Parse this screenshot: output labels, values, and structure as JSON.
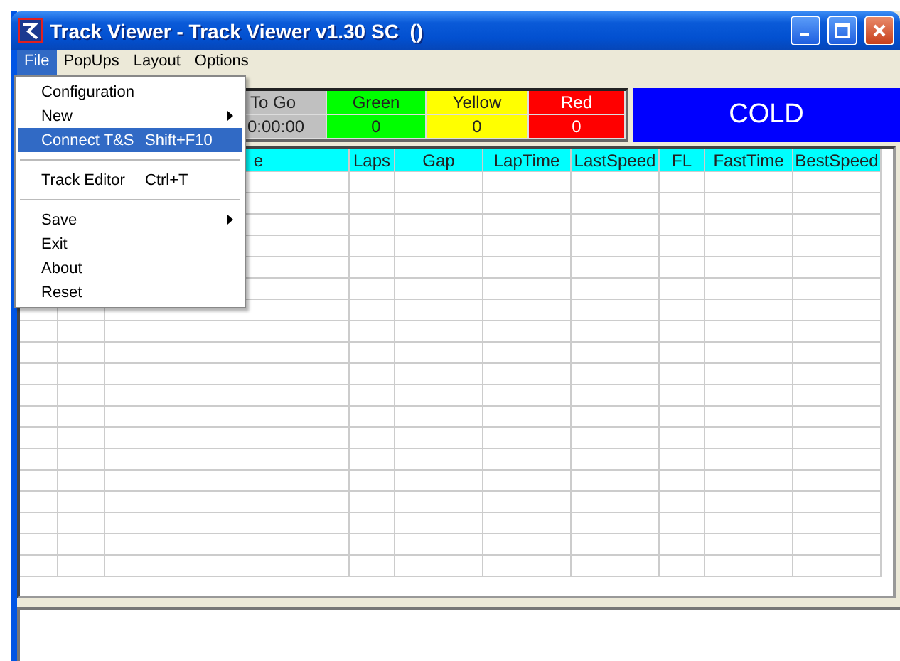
{
  "window": {
    "title": "Track Viewer - Track Viewer v1.30 SC  ()"
  },
  "menu_bar": [
    {
      "label": "File",
      "selected": true
    },
    {
      "label": "PopUps",
      "selected": false
    },
    {
      "label": "Layout",
      "selected": false
    },
    {
      "label": "Options",
      "selected": false
    }
  ],
  "file_menu": [
    {
      "kind": "item",
      "label": "Configuration",
      "selected": false
    },
    {
      "kind": "submenu",
      "label": "New",
      "selected": false
    },
    {
      "kind": "item",
      "label": "Connect T&S",
      "shortcut": "Shift+F10",
      "selected": true
    },
    {
      "kind": "separator"
    },
    {
      "kind": "item",
      "label": "Track Editor",
      "shortcut": "Ctrl+T",
      "selected": false
    },
    {
      "kind": "separator"
    },
    {
      "kind": "submenu",
      "label": "Save",
      "selected": false
    },
    {
      "kind": "item",
      "label": "Exit",
      "selected": false
    },
    {
      "kind": "item",
      "label": "About",
      "selected": false
    },
    {
      "kind": "item",
      "label": "Reset",
      "selected": false
    }
  ],
  "flag_panel": {
    "time": {
      "label": "To Go",
      "value": "0:00:00"
    },
    "flags": [
      {
        "label": "Green",
        "value": "0",
        "color": "#00ff00"
      },
      {
        "label": "Yellow",
        "value": "0",
        "color": "#ffff00"
      },
      {
        "label": "Red",
        "value": "0",
        "color": "#ff0000"
      }
    ]
  },
  "track_status": {
    "label": "COLD"
  },
  "table": {
    "columns": [
      "e",
      "Laps",
      "Gap",
      "LapTime",
      "LastSpeed",
      "FL",
      "FastTime",
      "BestSpeed"
    ]
  }
}
